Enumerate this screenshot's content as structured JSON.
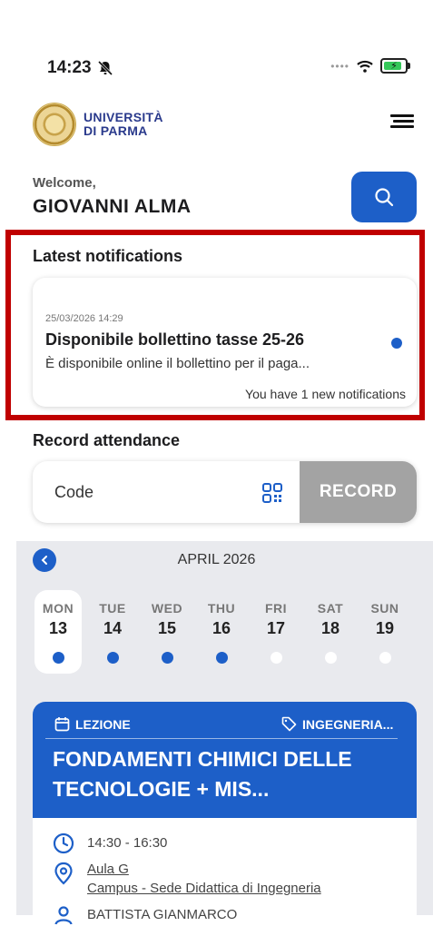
{
  "status": {
    "time": "14:23"
  },
  "header": {
    "logo_line1": "UNIVERSITÀ",
    "logo_line2": "DI PARMA"
  },
  "welcome": {
    "label": "Welcome,",
    "name": "GIOVANNI ALMA"
  },
  "notifications": {
    "title": "Latest notifications",
    "date": "25/03/2026 14:29",
    "headline": "Disponibile bollettino tasse 25-26",
    "body": "È disponibile online il bollettino per il paga...",
    "count_text": "You have 1 new notifications"
  },
  "attendance": {
    "title": "Record attendance",
    "placeholder": "Code",
    "button": "RECORD"
  },
  "calendar": {
    "month": "APRIL 2026",
    "days": [
      {
        "name": "MON",
        "date": "13",
        "has_event": true
      },
      {
        "name": "TUE",
        "date": "14",
        "has_event": true
      },
      {
        "name": "WED",
        "date": "15",
        "has_event": true
      },
      {
        "name": "THU",
        "date": "16",
        "has_event": true
      },
      {
        "name": "FRI",
        "date": "17",
        "has_event": false
      },
      {
        "name": "SAT",
        "date": "18",
        "has_event": false
      },
      {
        "name": "SUN",
        "date": "19",
        "has_event": false
      }
    ]
  },
  "lesson": {
    "type": "LEZIONE",
    "category": "INGEGNERIA...",
    "title": "FONDAMENTI CHIMICI DELLE TECNOLOGIE + MIS...",
    "time": "14:30 - 16:30",
    "room": "Aula G",
    "campus": "Campus - Sede Didattica di Ingegneria",
    "teacher": "BATTISTA GIANMARCO"
  },
  "colors": {
    "accent": "#1d5fc8",
    "highlight_frame": "#c00000",
    "record_disabled": "#a3a3a3"
  }
}
